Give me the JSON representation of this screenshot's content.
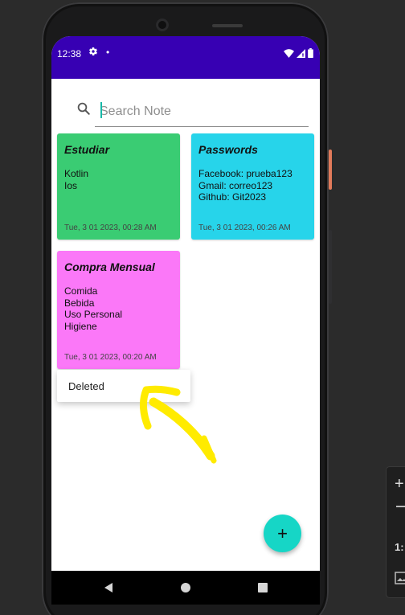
{
  "status_bar": {
    "time": "12:38",
    "dot": "•"
  },
  "search": {
    "placeholder": "Search Note"
  },
  "notes": [
    {
      "title": "Estudiar",
      "lines": [
        "Kotlin",
        "Ios"
      ],
      "date": "Tue, 3 01 2023, 00:28 AM",
      "color": "#3acc73"
    },
    {
      "title": "Passwords",
      "lines": [
        "Facebook: prueba123",
        "Gmail: correo123",
        "Github: Git2023"
      ],
      "date": "Tue, 3 01 2023, 00:26 AM",
      "color": "#27d4ea"
    },
    {
      "title": "Compra Mensual",
      "lines": [
        "Comida",
        "Bebida",
        "Uso Personal",
        "Higiene"
      ],
      "date": "Tue, 3 01 2023, 00:20 AM",
      "color": "#fb78f8"
    }
  ],
  "popup_menu": {
    "item": "Deleted"
  },
  "fab": {
    "label": "+",
    "color": "#16d6c6"
  },
  "toolbar": {
    "zoom_in": "+",
    "ratio": "1:"
  },
  "colors": {
    "status_bar": "#3700b3",
    "annotation_arrow": "#ffeb00"
  }
}
